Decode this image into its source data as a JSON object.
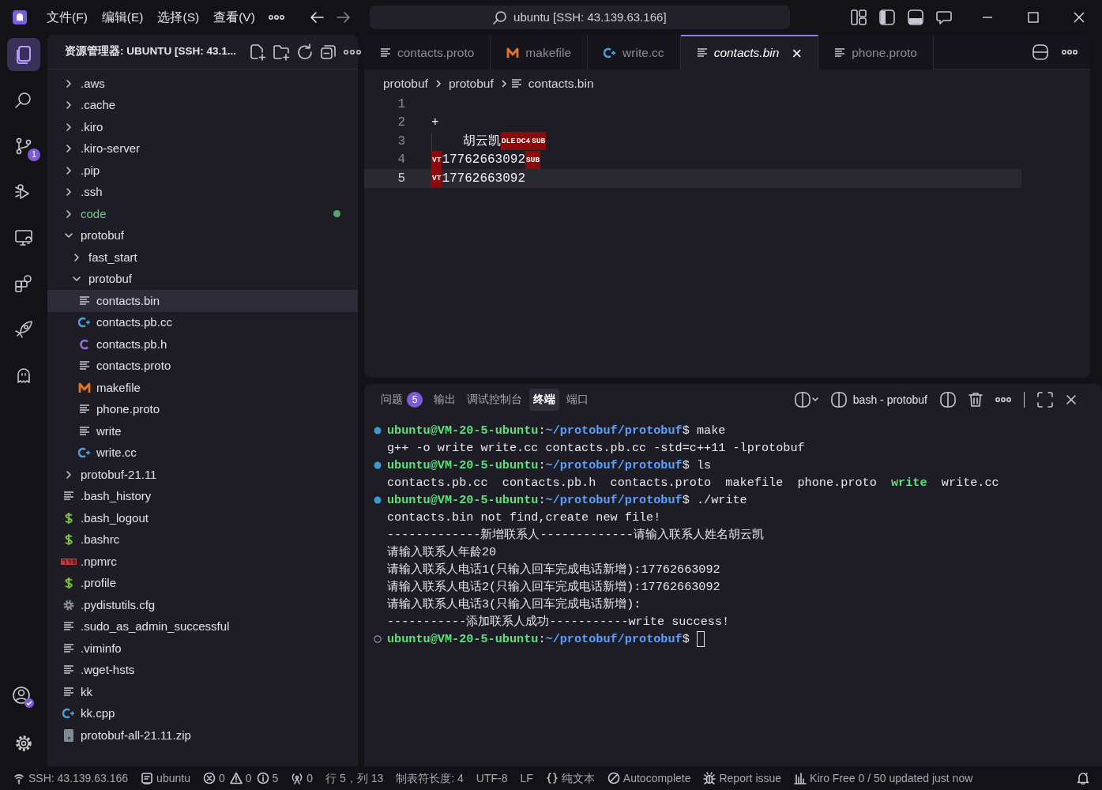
{
  "title_bar": {
    "menus": [
      "文件(F)",
      "编辑(E)",
      "选择(S)",
      "查看(V)"
    ],
    "search": "ubuntu [SSH: 43.139.63.166]"
  },
  "activity_bar": {
    "items": [
      {
        "selected": true
      },
      {
        "selected": false
      },
      {
        "selected": false,
        "badge": "1"
      },
      {
        "selected": false
      },
      {
        "selected": false
      },
      {
        "selected": false
      },
      {
        "selected": false
      },
      {
        "selected": false
      }
    ]
  },
  "explorer": {
    "title": "资源管理器: UBUNTU [SSH: 43.1...",
    "tree": [
      {
        "label": ".aws",
        "kind": "folder",
        "expanded": false,
        "selected": false,
        "modified": false
      },
      {
        "label": ".cache",
        "kind": "folder",
        "expanded": false,
        "selected": false,
        "modified": false
      },
      {
        "label": ".kiro",
        "kind": "folder",
        "expanded": false,
        "selected": false,
        "modified": false
      },
      {
        "label": ".kiro-server",
        "kind": "folder",
        "expanded": false,
        "selected": false,
        "modified": false
      },
      {
        "label": ".pip",
        "kind": "folder",
        "expanded": false,
        "selected": false,
        "modified": false
      },
      {
        "label": ".ssh",
        "kind": "folder",
        "expanded": false,
        "selected": false,
        "modified": false
      },
      {
        "label": "code",
        "kind": "folder",
        "expanded": false,
        "selected": false,
        "modified": true
      },
      {
        "label": "protobuf",
        "kind": "folder",
        "expanded": true,
        "selected": false,
        "modified": false,
        "children": [
          {
            "label": "fast_start",
            "kind": "folder",
            "expanded": false,
            "selected": false,
            "modified": false
          },
          {
            "label": "protobuf",
            "kind": "folder",
            "expanded": true,
            "selected": false,
            "modified": false,
            "children": [
              {
                "label": "contacts.bin",
                "kind": "text",
                "selected": true,
                "modified": false
              },
              {
                "label": "contacts.pb.cc",
                "kind": "cpp",
                "selected": false,
                "modified": false
              },
              {
                "label": "contacts.pb.h",
                "kind": "c",
                "selected": false,
                "modified": false
              },
              {
                "label": "contacts.proto",
                "kind": "text",
                "selected": false,
                "modified": false
              },
              {
                "label": "makefile",
                "kind": "makefile",
                "selected": false,
                "modified": false
              },
              {
                "label": "phone.proto",
                "kind": "text",
                "selected": false,
                "modified": false
              },
              {
                "label": "write",
                "kind": "text",
                "selected": false,
                "modified": false
              },
              {
                "label": "write.cc",
                "kind": "cpp",
                "selected": false,
                "modified": false
              }
            ]
          }
        ]
      },
      {
        "label": "protobuf-21.11",
        "kind": "folder",
        "expanded": false,
        "selected": false,
        "modified": false
      },
      {
        "label": ".bash_history",
        "kind": "text",
        "selected": false,
        "modified": false
      },
      {
        "label": ".bash_logout",
        "kind": "shell",
        "selected": false,
        "modified": false
      },
      {
        "label": ".bashrc",
        "kind": "shell",
        "selected": false,
        "modified": false
      },
      {
        "label": ".npmrc",
        "kind": "npm",
        "selected": false,
        "modified": false
      },
      {
        "label": ".profile",
        "kind": "shell",
        "selected": false,
        "modified": false
      },
      {
        "label": ".pydistutils.cfg",
        "kind": "config",
        "selected": false,
        "modified": false
      },
      {
        "label": ".sudo_as_admin_successful",
        "kind": "text",
        "selected": false,
        "modified": false
      },
      {
        "label": ".viminfo",
        "kind": "text",
        "selected": false,
        "modified": false
      },
      {
        "label": ".wget-hsts",
        "kind": "text",
        "selected": false,
        "modified": false
      },
      {
        "label": "kk",
        "kind": "text",
        "selected": false,
        "modified": false
      },
      {
        "label": "kk.cpp",
        "kind": "cpp",
        "selected": false,
        "modified": false
      },
      {
        "label": "protobuf-all-21.11.zip",
        "kind": "zip",
        "selected": false,
        "modified": false
      }
    ]
  },
  "tabs": [
    {
      "label": "contacts.proto",
      "kind": "text",
      "selected": false,
      "preview": false
    },
    {
      "label": "makefile",
      "kind": "makefile",
      "selected": false,
      "preview": false
    },
    {
      "label": "write.cc",
      "kind": "cpp",
      "selected": false,
      "preview": false
    },
    {
      "label": "contacts.bin",
      "kind": "text",
      "selected": true,
      "preview": true,
      "close": "×"
    },
    {
      "label": "phone.proto",
      "kind": "text",
      "selected": false,
      "preview": false
    }
  ],
  "breadcrumb": [
    "protobuf",
    "protobuf",
    "contacts.bin"
  ],
  "editor": {
    "lines": [
      {
        "number": "1",
        "current": false
      },
      {
        "number": "2",
        "current": false,
        "segments": [
          {
            "kind": "text",
            "text": "+"
          }
        ]
      },
      {
        "number": "3",
        "current": false,
        "segments": [
          {
            "kind": "indent"
          },
          {
            "kind": "text",
            "text": "胡云凯"
          },
          {
            "kind": "control",
            "text": "DLE"
          },
          {
            "kind": "control",
            "text": "DC4"
          },
          {
            "kind": "control",
            "text": "SUB"
          }
        ]
      },
      {
        "number": "4",
        "current": false,
        "segments": [
          {
            "kind": "control",
            "text": "VT"
          },
          {
            "kind": "text",
            "text": "17762663092"
          },
          {
            "kind": "control",
            "text": "SUB"
          }
        ]
      },
      {
        "number": "5",
        "current": true,
        "segments": [
          {
            "kind": "control",
            "text": "VT"
          },
          {
            "kind": "text",
            "text": "17762663092"
          }
        ]
      }
    ]
  },
  "panel": {
    "tabs": [
      {
        "label": "问题",
        "badge": "5",
        "selected": false
      },
      {
        "label": "输出",
        "selected": false
      },
      {
        "label": "调试控制台",
        "selected": false
      },
      {
        "label": "终端",
        "selected": true
      },
      {
        "label": "端口",
        "selected": false
      }
    ],
    "terminal_name": "bash - protobuf",
    "terminal": [
      {
        "kind": "prompt",
        "done": true,
        "segments": [
          {
            "kind": "user",
            "text": "ubuntu@VM-20-5-ubuntu"
          },
          {
            "kind": "plain",
            "text": ":"
          },
          {
            "kind": "path",
            "text": "~/protobuf/protobuf"
          },
          {
            "kind": "plain",
            "text": "$ make"
          }
        ]
      },
      {
        "kind": "output",
        "segments": [
          {
            "kind": "plain",
            "text": "g++ -o write write.cc contacts.pb.cc -std=c++11 -lprotobuf"
          }
        ]
      },
      {
        "kind": "prompt",
        "done": true,
        "segments": [
          {
            "kind": "user",
            "text": "ubuntu@VM-20-5-ubuntu"
          },
          {
            "kind": "plain",
            "text": ":"
          },
          {
            "kind": "path",
            "text": "~/protobuf/protobuf"
          },
          {
            "kind": "plain",
            "text": "$ ls"
          }
        ]
      },
      {
        "kind": "output",
        "segments": [
          {
            "kind": "plain",
            "text": "contacts.pb.cc  contacts.pb.h  contacts.proto  makefile  phone.proto  "
          },
          {
            "kind": "exec",
            "text": "write"
          },
          {
            "kind": "plain",
            "text": "  write.cc"
          }
        ]
      },
      {
        "kind": "prompt",
        "done": true,
        "segments": [
          {
            "kind": "user",
            "text": "ubuntu@VM-20-5-ubuntu"
          },
          {
            "kind": "plain",
            "text": ":"
          },
          {
            "kind": "path",
            "text": "~/protobuf/protobuf"
          },
          {
            "kind": "plain",
            "text": "$ ./write"
          }
        ]
      },
      {
        "kind": "output",
        "segments": [
          {
            "kind": "plain",
            "text": "contacts.bin not find,create new file!"
          }
        ]
      },
      {
        "kind": "output",
        "segments": [
          {
            "kind": "plain",
            "text": "-------------新增联系人-------------请输入联系人姓名胡云凯"
          }
        ]
      },
      {
        "kind": "output",
        "segments": [
          {
            "kind": "plain",
            "text": "请输入联系人年龄20"
          }
        ]
      },
      {
        "kind": "output",
        "segments": [
          {
            "kind": "plain",
            "text": "请输入联系人电话1(只输入回车完成电话新增):17762663092"
          }
        ]
      },
      {
        "kind": "output",
        "segments": [
          {
            "kind": "plain",
            "text": "请输入联系人电话2(只输入回车完成电话新增):17762663092"
          }
        ]
      },
      {
        "kind": "output",
        "segments": [
          {
            "kind": "plain",
            "text": "请输入联系人电话3(只输入回车完成电话新增):"
          }
        ]
      },
      {
        "kind": "output",
        "segments": [
          {
            "kind": "plain",
            "text": "-----------添加联系人成功-----------write success!"
          }
        ]
      },
      {
        "kind": "prompt",
        "done": false,
        "cursor": true,
        "segments": [
          {
            "kind": "user",
            "text": "ubuntu@VM-20-5-ubuntu"
          },
          {
            "kind": "plain",
            "text": ":"
          },
          {
            "kind": "path",
            "text": "~/protobuf/protobuf"
          },
          {
            "kind": "plain",
            "text": "$ "
          }
        ]
      }
    ]
  },
  "status_bar": [
    {
      "kind": "remote",
      "text": "SSH: 43.139.63.166"
    },
    {
      "kind": "terminal",
      "text": "ubuntu"
    },
    {
      "kind": "error",
      "text": "0"
    },
    {
      "kind": "warning",
      "text": "0"
    },
    {
      "kind": "info",
      "text": "5"
    },
    {
      "kind": "ports",
      "text": "0"
    },
    {
      "text": "行 5，列 13"
    },
    {
      "text": "制表符长度: 4"
    },
    {
      "text": "UTF-8"
    },
    {
      "text": "LF"
    },
    {
      "kind": "braces",
      "text": "纯文本"
    },
    {
      "kind": "blocked",
      "text": "Autocomplete"
    },
    {
      "kind": "bug",
      "text": "Report issue"
    },
    {
      "kind": "bars",
      "text": "Kiro Free 0 / 50 updated just now"
    },
    {
      "kind": "bell"
    }
  ]
}
